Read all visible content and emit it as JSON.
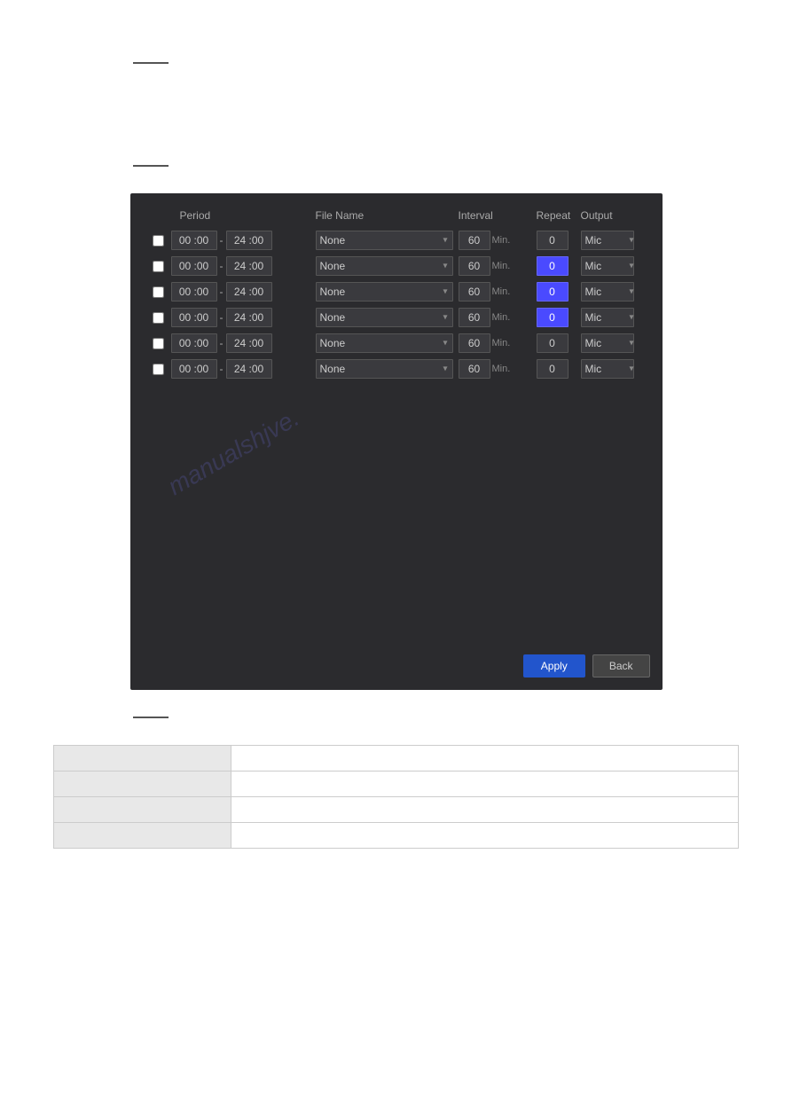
{
  "page": {
    "section1_line": true,
    "section2_line": true,
    "section3_line": true,
    "text_block1": "",
    "text_block2": "",
    "watermark": "manualshjve."
  },
  "panel": {
    "headers": {
      "period": "Period",
      "filename": "File Name",
      "interval": "Interval",
      "repeat": "Repeat",
      "output": "Output"
    },
    "rows": [
      {
        "id": 1,
        "checked": false,
        "start": "00 :00",
        "end": "24 :00",
        "filename": "None",
        "interval": "60",
        "repeat": "0",
        "output": "Mic",
        "repeat_highlight": false
      },
      {
        "id": 2,
        "checked": false,
        "start": "00 :00",
        "end": "24 :00",
        "filename": "None",
        "interval": "60",
        "repeat": "0",
        "output": "Mic",
        "repeat_highlight": true
      },
      {
        "id": 3,
        "checked": false,
        "start": "00 :00",
        "end": "24 :00",
        "filename": "None",
        "interval": "60",
        "repeat": "0",
        "output": "Mic",
        "repeat_highlight": true
      },
      {
        "id": 4,
        "checked": false,
        "start": "00 :00",
        "end": "24 :00",
        "filename": "None",
        "interval": "60",
        "repeat": "0",
        "output": "Mic",
        "repeat_highlight": true
      },
      {
        "id": 5,
        "checked": false,
        "start": "00 :00",
        "end": "24 :00",
        "filename": "None",
        "interval": "60",
        "repeat": "0",
        "output": "Mic",
        "repeat_highlight": false
      },
      {
        "id": 6,
        "checked": false,
        "start": "00 :00",
        "end": "24 :00",
        "filename": "None",
        "interval": "60",
        "repeat": "0",
        "output": "Mic",
        "repeat_highlight": false
      }
    ],
    "buttons": {
      "apply": "Apply",
      "back": "Back"
    }
  },
  "table": {
    "col1_header": "",
    "col2_header": "",
    "rows": [
      {
        "col1": "",
        "col2": ""
      },
      {
        "col1": "",
        "col2": ""
      },
      {
        "col1": "",
        "col2": ""
      },
      {
        "col1": "",
        "col2": ""
      }
    ]
  }
}
